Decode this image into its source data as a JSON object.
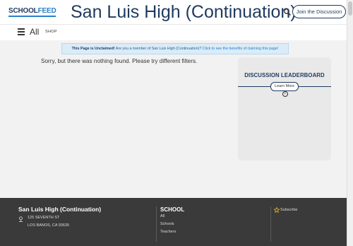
{
  "header": {
    "logo_school": "SCHOOL",
    "logo_feed": "FEED",
    "title": "San Luis High (Continuation)",
    "join_label": "Join the Discussion"
  },
  "nav": {
    "all_label": "All",
    "shop_label": "SHOP"
  },
  "banner": {
    "bold": "This Page is Unclaimed!",
    "text": " Are you a member of San Luis High (Continuation)? ",
    "link": "Click to see the benefits of claiming this page!"
  },
  "main": {
    "empty_message": "Sorry, but there was nothing found. Please try different filters."
  },
  "sidebar": {
    "leaderboard_title": "DISCUSSION LEADERBOARD",
    "learn_more_label": "Learn More",
    "learn_more_icon": "?"
  },
  "footer": {
    "school_name": "San Luis High (Continuation)",
    "address_line1": "125 SEVENTH ST",
    "address_line2": "LOS BANOS, CA 93635",
    "section_title": "SCHOOL",
    "links": [
      "All",
      "Schools",
      "Teachers"
    ],
    "subscribe_label": "Subscribe"
  },
  "colors": {
    "brand_navy": "#1f3a5f",
    "brand_blue": "#2a7fc9",
    "banner_bg": "#d9ecf8",
    "footer_bg": "#3a3a3a",
    "star": "#f5c518"
  }
}
